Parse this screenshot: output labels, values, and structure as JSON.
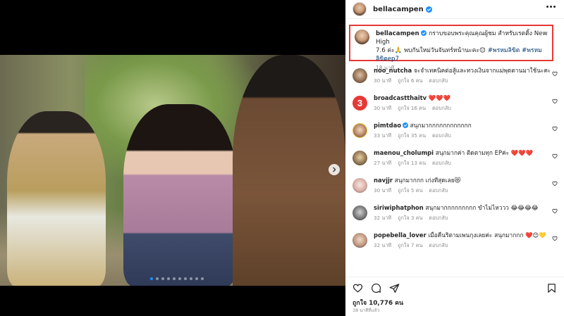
{
  "post": {
    "media_dots_count": 10,
    "active_dot": 0
  },
  "header": {
    "username": "bellacampen"
  },
  "caption": {
    "username": "bellacampen",
    "text_line1": "กราบขอบพระคุณคุณผู้ชม สำหรับเรตติ้ง New High",
    "text_line2_prefix": "7.6 ค่ะ🙏 พบกันใหม่วันจันทร์หน้านะคะ😊 ",
    "hashtag1": "#พรหมลิขิต",
    "hashtag2": "#พรหมลิขิตep7",
    "time": "18 นาที"
  },
  "comments": [
    {
      "username": "noo_nutcha",
      "text": "จะจำเทคนิคต่อสู้และทวงเงินจากแม่พุดตานมาใช้นะคะ",
      "time": "30 นาที",
      "likes": "ถูกใจ 6 คน",
      "reply": "ตอบกลับ",
      "verified": false
    },
    {
      "username": "broadcastthaitv",
      "text": "❤️❤️❤️",
      "time": "30 นาที",
      "likes": "ถูกใจ 16 คน",
      "reply": "ตอบกลับ",
      "verified": false
    },
    {
      "username": "pimtdao",
      "text": "สนุกมากกกกกกกกกกกก",
      "time": "33 นาที",
      "likes": "ถูกใจ 35 คน",
      "reply": "ตอบกลับ",
      "verified": true
    },
    {
      "username": "maenou_cholumpi",
      "text": "สนุกมากค่า ติดตามทุก EPค่ะ ❤️❤️❤️",
      "time": "27 นาที",
      "likes": "ถูกใจ 13 คน",
      "reply": "ตอบกลับ",
      "verified": false
    },
    {
      "username": "navjjr",
      "text": "สนุกมากกก เก่งที่สุดเลย😻",
      "time": "30 นาที",
      "likes": "ถูกใจ 5 คน",
      "reply": "ตอบกลับ",
      "verified": false
    },
    {
      "username": "siriwiphatphon",
      "text": "สนุกมากกกกกกกกก ขำไม่ไหววว 😂😂😂😂",
      "time": "32 นาที",
      "likes": "ถูกใจ 3 คน",
      "reply": "ตอบกลับ",
      "verified": false
    },
    {
      "username": "popebella_lover",
      "text": "เมื่อคืนริตามเพนกุงเลยค่ะ สนุกมากกก ❤️😊💛",
      "time": "32 นาที",
      "likes": "ถูกใจ 7 คน",
      "reply": "ตอบกลับ",
      "verified": false
    }
  ],
  "footer": {
    "likes": "ถูกใจ 10,776 คน",
    "posted": "38 นาทีที่แล้ว"
  },
  "icons": {
    "like": "heart-icon",
    "comment": "comment-icon",
    "share": "share-icon",
    "save": "bookmark-icon",
    "more": "more-options-icon",
    "next": "chevron-right-icon"
  },
  "colors": {
    "verified": "#1e90ff",
    "highlight_border": "#e53935",
    "hashtag": "#00376b",
    "muted": "#8e8e8e"
  }
}
